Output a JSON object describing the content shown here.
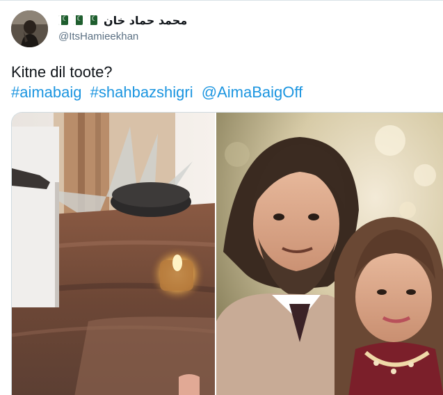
{
  "user": {
    "display_name": "محمد حماد خان",
    "flags": [
      "pk-flag",
      "pk-flag",
      "pk-flag"
    ],
    "handle": "@ItsHamieekhan"
  },
  "tweet": {
    "text": "Kitne dil toote?",
    "hashtags": [
      "#aimabaig",
      "#shahbazshigri",
      "@AimaBaigOff"
    ]
  },
  "colors": {
    "link": "#1b95e0",
    "text": "#0f1419",
    "muted": "#5b7083"
  }
}
